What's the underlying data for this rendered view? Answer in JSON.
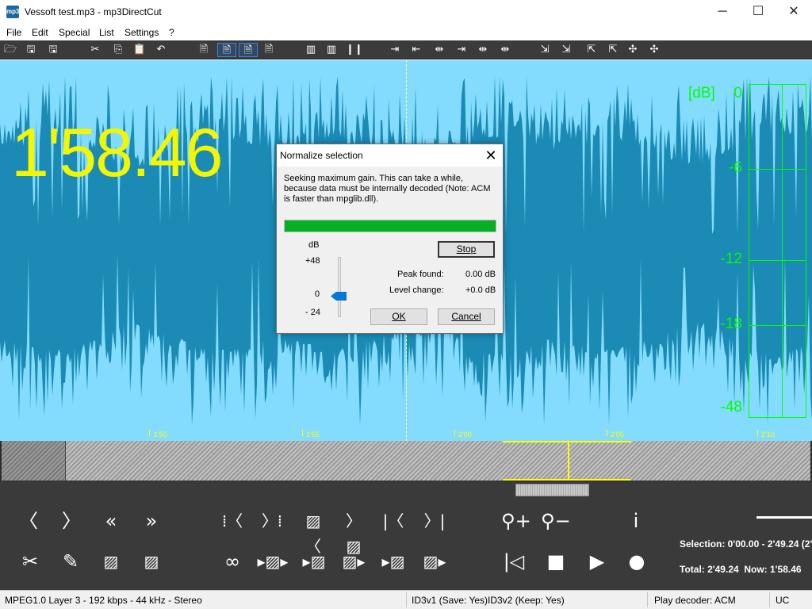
{
  "window": {
    "app_icon_text": "mp3",
    "title": "Vessoft test.mp3 - mp3DirectCut",
    "minimize": "─",
    "maximize": "☐",
    "close": "✕"
  },
  "menu": [
    "File",
    "Edit",
    "Special",
    "List",
    "Settings",
    "?"
  ],
  "toolbar_icons": [
    "open-icon",
    "save-icon",
    "save-split-icon",
    "cut-icon",
    "copy-icon",
    "paste-icon",
    "undo-icon",
    "doc-icon",
    "doc-a-icon",
    "doc-b-icon",
    "doc-c-icon",
    "split-bars-icon",
    "split-bars2-icon",
    "split-bars3-icon",
    "pause-bars-icon",
    "cue-1-icon",
    "cue-2-icon",
    "cue-3-icon",
    "cue-4-icon",
    "cue-5-icon",
    "cue-6-icon",
    "marker-1-icon",
    "marker-2-icon",
    "marker-3-icon",
    "marker-4-icon",
    "marker-5-icon",
    "marker-6-icon"
  ],
  "waveform": {
    "time_readout": "1'58.46",
    "ruler": [
      "1'50",
      "1'55",
      "2'00",
      "2'05",
      "2'10"
    ],
    "db_label": "[dB]",
    "db_scale": [
      "0",
      "-6",
      "-12",
      "-18",
      "-48"
    ],
    "colors": {
      "background": "#83dcfd",
      "wave": "#1b8ab5",
      "readout": "#f2f700",
      "meter": "#00ff00"
    }
  },
  "controls": {
    "row1": [
      "prev-icon",
      "next-icon",
      "rewind-icon",
      "fast-forward-icon",
      "to-begin-sel-icon",
      "to-end-sel-icon",
      "sel-begin-icon",
      "sel-end-icon",
      "goto-start-icon",
      "goto-end-icon",
      "zoom-in-icon",
      "zoom-out-icon",
      "info-icon"
    ],
    "row2": [
      "cut-icon",
      "pencil-icon",
      "fade-in-icon",
      "fade-out-icon",
      "loop-icon",
      "play-selection-icon",
      "play-to-cursor-icon",
      "play-from-icon",
      "play-cursor-icon",
      "play-end-icon",
      "skip-back-icon",
      "stop-icon",
      "play-icon",
      "record-icon"
    ],
    "selection": "Selection: 0'00.00 - 2'49.24 (2'",
    "total": "Total: 2'49.24",
    "now": "Now: 1'58.46"
  },
  "status": {
    "format": "MPEG1.0 Layer 3 - 192 kbps - 44 kHz - Stereo",
    "id3v1": "ID3v1 (Save: Yes)",
    "id3v2": "ID3v2 (Keep: Yes)",
    "decoder": "Play decoder: ACM",
    "mode": "UC"
  },
  "dialog": {
    "title": "Normalize selection",
    "close": "✕",
    "message": "Seeking maximum gain. This can take a while, because data must be internally decoded (Note: ACM is faster than mpglib.dll).",
    "progress": 1.0,
    "db_caption": "dB",
    "db_top": "+48",
    "db_mid": "0",
    "db_bot": "- 24",
    "slider_value_db": 0,
    "stop": "Stop",
    "peak_label": "Peak found:",
    "peak_value": "0.00 dB",
    "level_label": "Level change:",
    "level_value": "+0.0 dB",
    "ok": "OK",
    "cancel": "Cancel"
  }
}
